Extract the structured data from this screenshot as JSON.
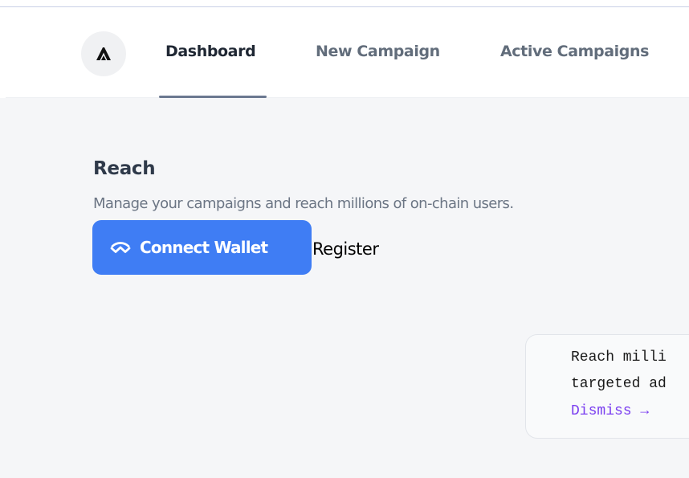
{
  "nav": {
    "logo_icon": "peak-triangle-icon",
    "tabs": [
      {
        "label": "Dashboard",
        "active": true
      },
      {
        "label": "New Campaign",
        "active": false
      },
      {
        "label": "Active Campaigns",
        "active": false
      }
    ]
  },
  "main": {
    "title": "Reach",
    "subtitle": "Manage your campaigns and reach millions of on-chain users.",
    "connect_button": {
      "label": "Connect Wallet",
      "icon": "wallet-connect-icon",
      "color": "#3f7df4"
    },
    "register_label": "Register"
  },
  "banner": {
    "line1": "Reach milli",
    "line2": "targeted ad",
    "dismiss_label": "Dismiss →",
    "dismiss_color": "#7b3ff0"
  }
}
